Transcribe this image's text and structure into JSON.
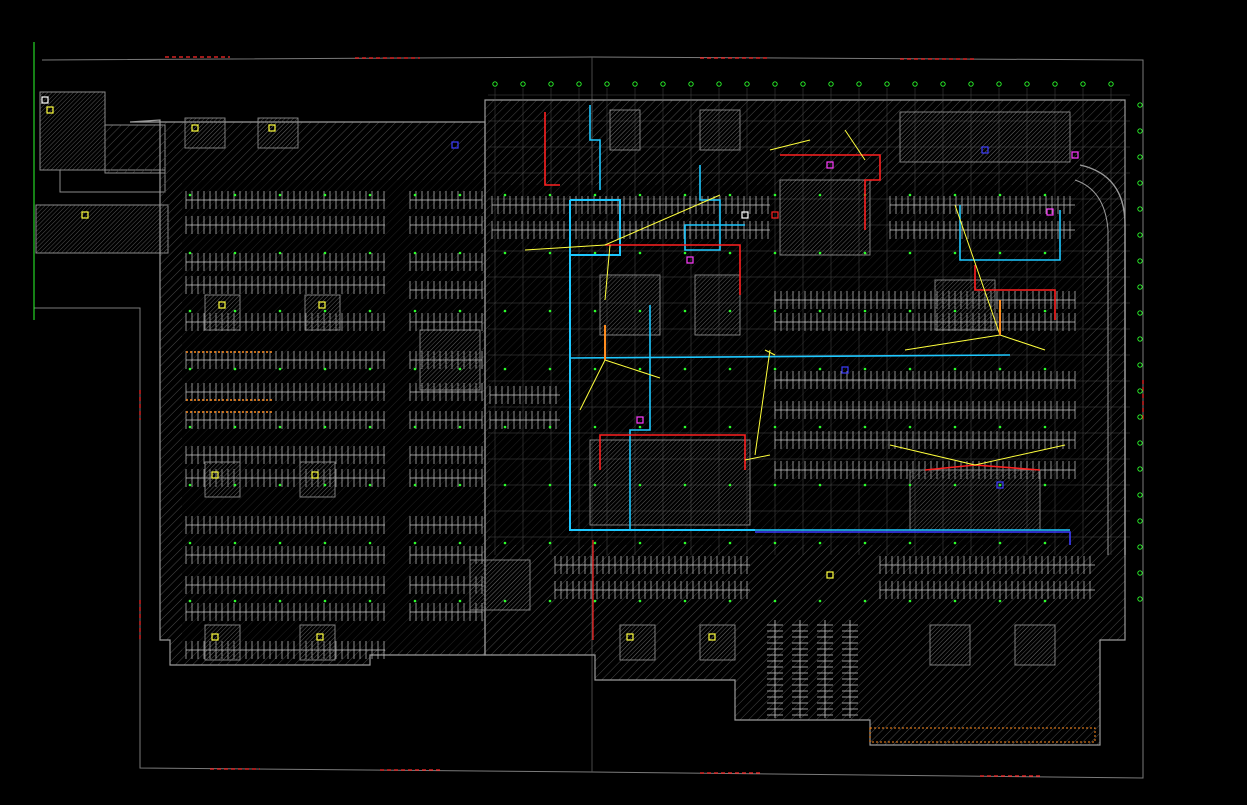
{
  "drawing": {
    "background": "#000000",
    "colors": {
      "walls": "#8a8a8a",
      "stalls": "#c8c8c8",
      "grid": "#5a5a5a",
      "hatch": "#4a4a4a",
      "columns": "#2cff2c",
      "boundary_dash": "#ff2a2a",
      "duct_cyan": "#1ec8ff",
      "pipe_red": "#ff2020",
      "pipe_yellow": "#ffff3c",
      "equipment_blue": "#3c3cff",
      "accent_magenta": "#ff3cff",
      "accent_orange": "#ff8c1e",
      "accent_white": "#ffffff"
    }
  }
}
